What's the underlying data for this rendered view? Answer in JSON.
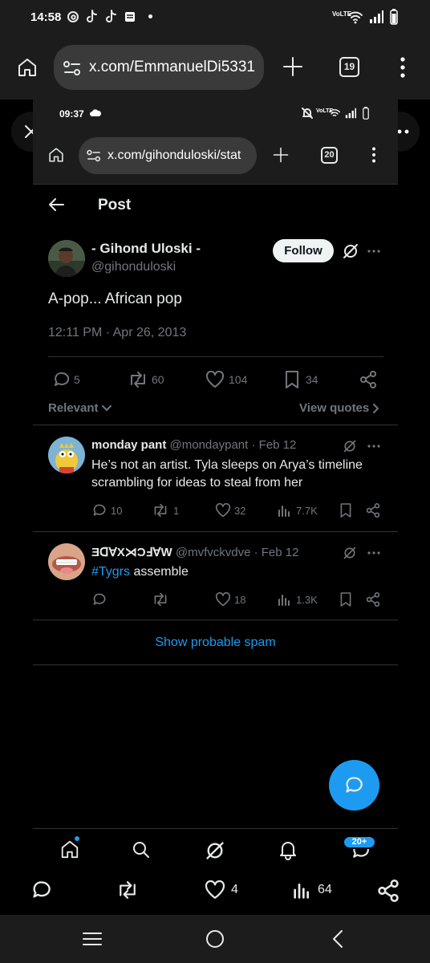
{
  "outer_status": {
    "time": "14:58",
    "net": "VoLTE"
  },
  "outer_browser": {
    "url": "x.com/EmmanuelDi5331",
    "tab_count": "19"
  },
  "inner_status": {
    "time": "09:37",
    "net": "VoLTE"
  },
  "inner_browser": {
    "url": "x.com/gihonduloski/stat",
    "tab_count": "20"
  },
  "header": {
    "title": "Post"
  },
  "post": {
    "author_name": "- Gihond Uloski -",
    "author_handle": "@gihonduloski",
    "follow_label": "Follow",
    "text": "A-pop... African pop",
    "timestamp": "12:11 PM · Apr 26, 2013",
    "replies": "5",
    "reposts": "60",
    "likes": "104",
    "bookmarks": "34"
  },
  "filter": {
    "sort_label": "Relevant",
    "quotes_label": "View quotes"
  },
  "replies": [
    {
      "name": "monday pant",
      "handle": "@mondaypant",
      "date": "Feb 12",
      "text": "He’s not an artist. Tyla sleeps on Arya’s timeline scrambling for ideas to steal from her",
      "replies": "10",
      "reposts": "1",
      "likes": "32",
      "views": "7.7K"
    },
    {
      "name": "ƎᗡⱯX⋊ƆℲⱯW",
      "handle": "@mvfvckvdve",
      "date": "Feb 12",
      "hashtag": "#Tygrs",
      "text": " assemble",
      "likes": "18",
      "views": "1.3K"
    }
  ],
  "spam_label": "Show probable spam",
  "bottom_nav": {
    "badge": "20+"
  },
  "outer_actions": {
    "likes": "4",
    "views": "64"
  },
  "colors": {
    "accent": "#1d9bf0",
    "background": "#000000",
    "chrome": "#1c1c1c"
  }
}
